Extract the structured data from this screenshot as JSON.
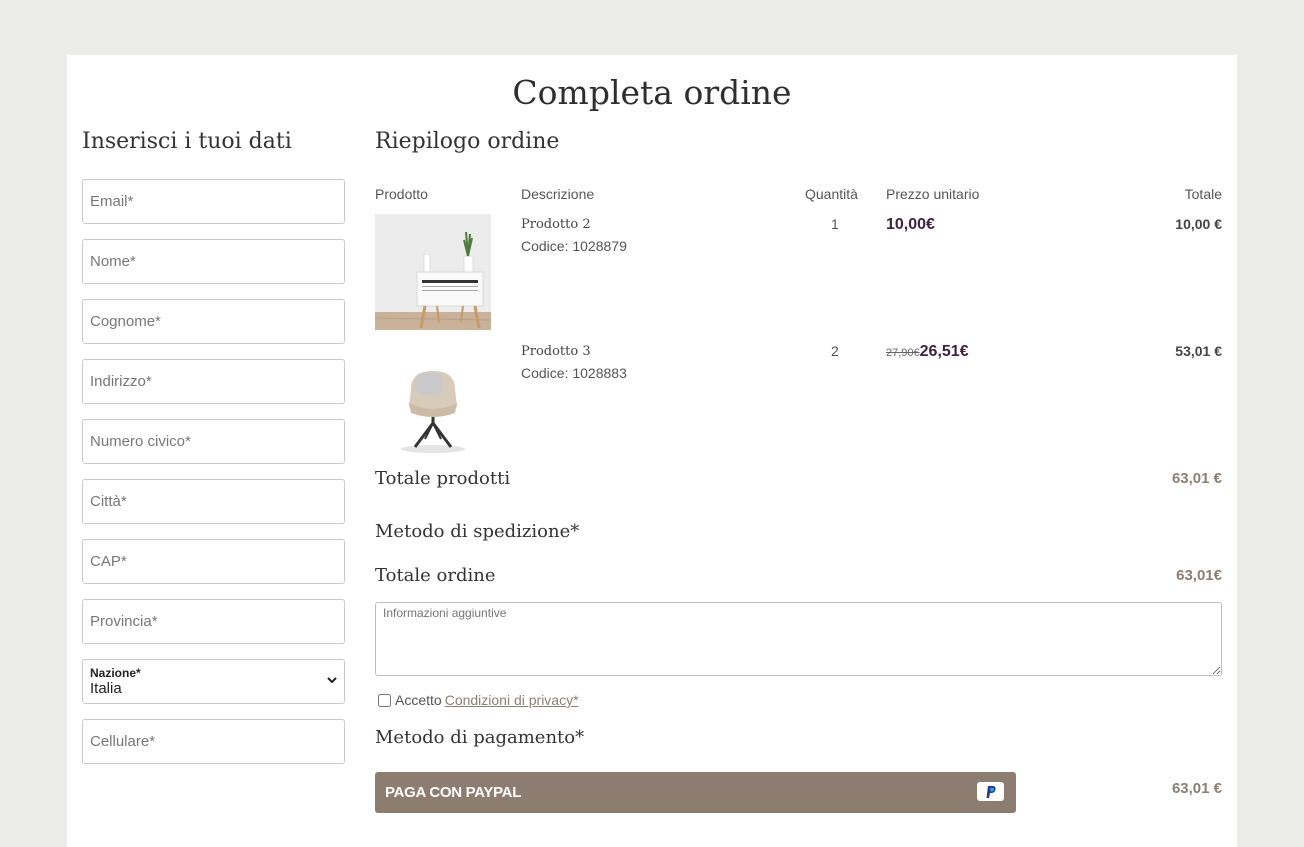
{
  "page": {
    "title": "Completa ordine"
  },
  "form": {
    "heading": "Inserisci i tuoi dati",
    "email": "Email*",
    "nome": "Nome*",
    "cognome": "Cognome*",
    "indirizzo": "Indirizzo*",
    "numero_civico": "Numero civico*",
    "citta": "Città*",
    "cap": "CAP*",
    "provincia": "Provincia*",
    "nazione_label": "Nazione*",
    "nazione_value": "Italia",
    "cellulare": "Cellulare*"
  },
  "summary": {
    "heading": "Riepilogo ordine",
    "columns": {
      "product": "Prodotto",
      "description": "Descrizione",
      "quantity": "Quantità",
      "unit_price": "Prezzo unitario",
      "total": "Totale"
    },
    "items": [
      {
        "name": "Prodotto 2",
        "code": "Codice: 1028879",
        "quantity": "1",
        "old_price": "",
        "price": "10,00€",
        "total": "10,00 €",
        "image": "white-nightstand-image"
      },
      {
        "name": "Prodotto 3",
        "code": "Codice: 1028883",
        "quantity": "2",
        "old_price": "27,90€",
        "price": "26,51€",
        "total": "53,01 €",
        "image": "beige-armchair-image"
      }
    ],
    "products_total_label": "Totale prodotti",
    "products_total_value": "63,01 €",
    "shipping_label": "Metodo di spedizione*",
    "order_total_label": "Totale ordine",
    "order_total_value": "63,01€",
    "notes_placeholder": "Informazioni aggiuntive",
    "privacy_prefix": "Accetto",
    "privacy_link": "Condizioni di privacy*",
    "payment_label": "Metodo di pagamento*",
    "paypal_button": "PAGA CON PAYPAL",
    "payment_total": "63,01 €"
  },
  "colors": {
    "page_background": "#ecedeb",
    "accent": "#8c7d70",
    "price": "#3e2340"
  }
}
